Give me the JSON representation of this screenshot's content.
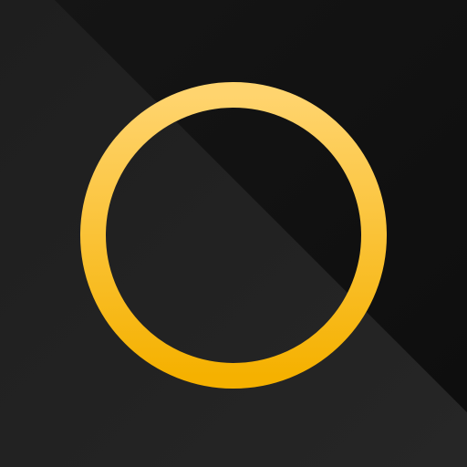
{
  "icon": {
    "name": "ring-icon",
    "background_dark": "#0e0e0e",
    "background_light": "#262626",
    "ring_top_color": "#FFD46E",
    "ring_bottom_color": "#F5B100"
  }
}
